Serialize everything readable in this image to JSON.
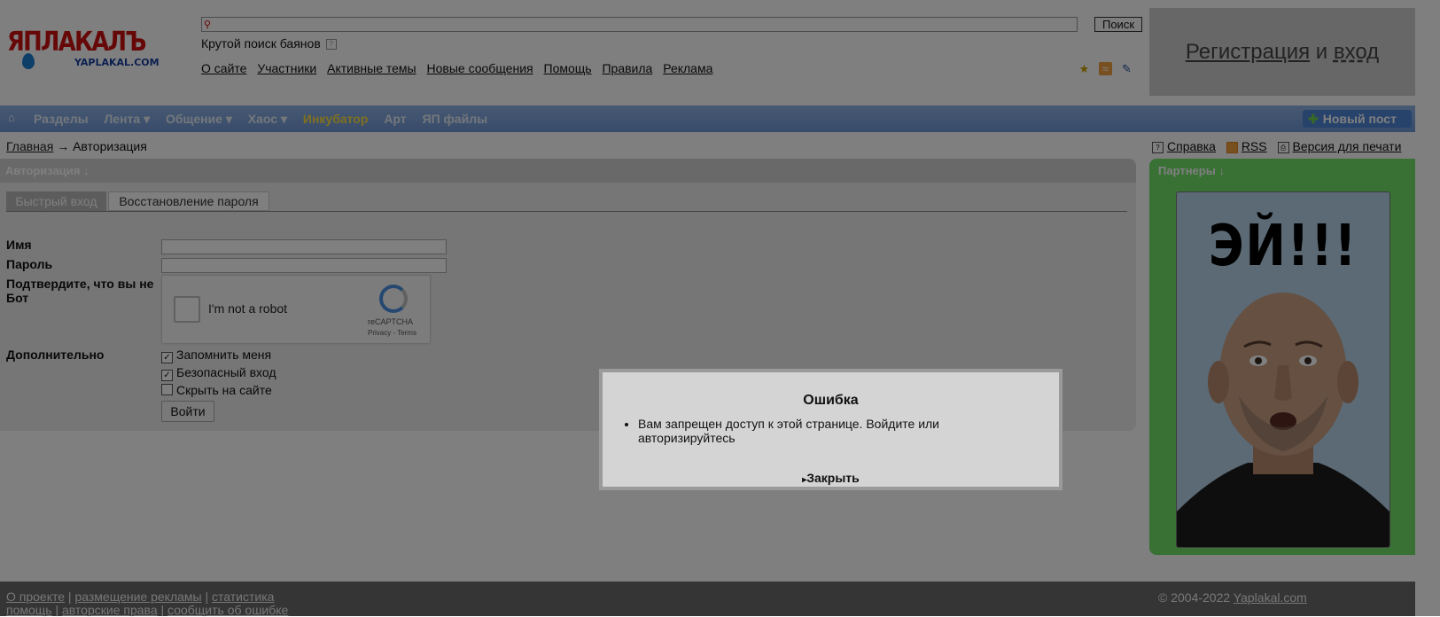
{
  "logo": {
    "big": "ЯПЛАКАЛЪ",
    "small": "YAPLAKAL.COM"
  },
  "header": {
    "search_button": "Поиск",
    "tagline": "Крутой поиск баянов",
    "nav": [
      "О сайте",
      "Участники",
      "Активные темы",
      "Новые сообщения",
      "Помощь",
      "Правила",
      "Реклама"
    ],
    "register": "Регистрация",
    "and": "и",
    "login": "вход"
  },
  "navbar": {
    "items": [
      "Разделы",
      "Лента ▾",
      "Общение ▾",
      "Хаос ▾",
      "Инкубатор",
      "Арт",
      "ЯП файлы"
    ],
    "new_post": "Новый пост"
  },
  "breadcrumb": {
    "home": "Главная",
    "sep": "→",
    "current": "Авторизация"
  },
  "toplinks": {
    "help": "Справка",
    "rss": "RSS",
    "print": "Версия для печати"
  },
  "auth": {
    "title": "Авторизация ↓",
    "tab_quick": "Быстрый вход",
    "tab_restore": "Восстановление пароля",
    "name_label": "Имя",
    "password_label": "Пароль",
    "confirm_label": "Подтвердите, что вы не Бот",
    "captcha_text": "I'm not a robot",
    "captcha_brand": "reCAPTCHA",
    "captcha_terms": "Privacy - Terms",
    "extra_label": "Дополнительно",
    "remember": "Запомнить меня",
    "secure": "Безопасный вход",
    "hide": "Скрыть на сайте",
    "login_button": "Войти"
  },
  "partners": {
    "title": "Партнеры ↓",
    "ad_text": "ЭЙ!!!"
  },
  "footer": {
    "links_row1": [
      "О проекте",
      "размещение рекламы",
      "статистика"
    ],
    "links_row2": [
      "помощь",
      "авторские права",
      "сообщить об ошибке"
    ],
    "copyright": "© 2004-2022",
    "site": "Yaplakal.com"
  },
  "modal": {
    "title": "Ошибка",
    "message": "Вам запрещен доступ к этой странице. Войдите или авторизируйтесь",
    "close": "Закрыть"
  }
}
